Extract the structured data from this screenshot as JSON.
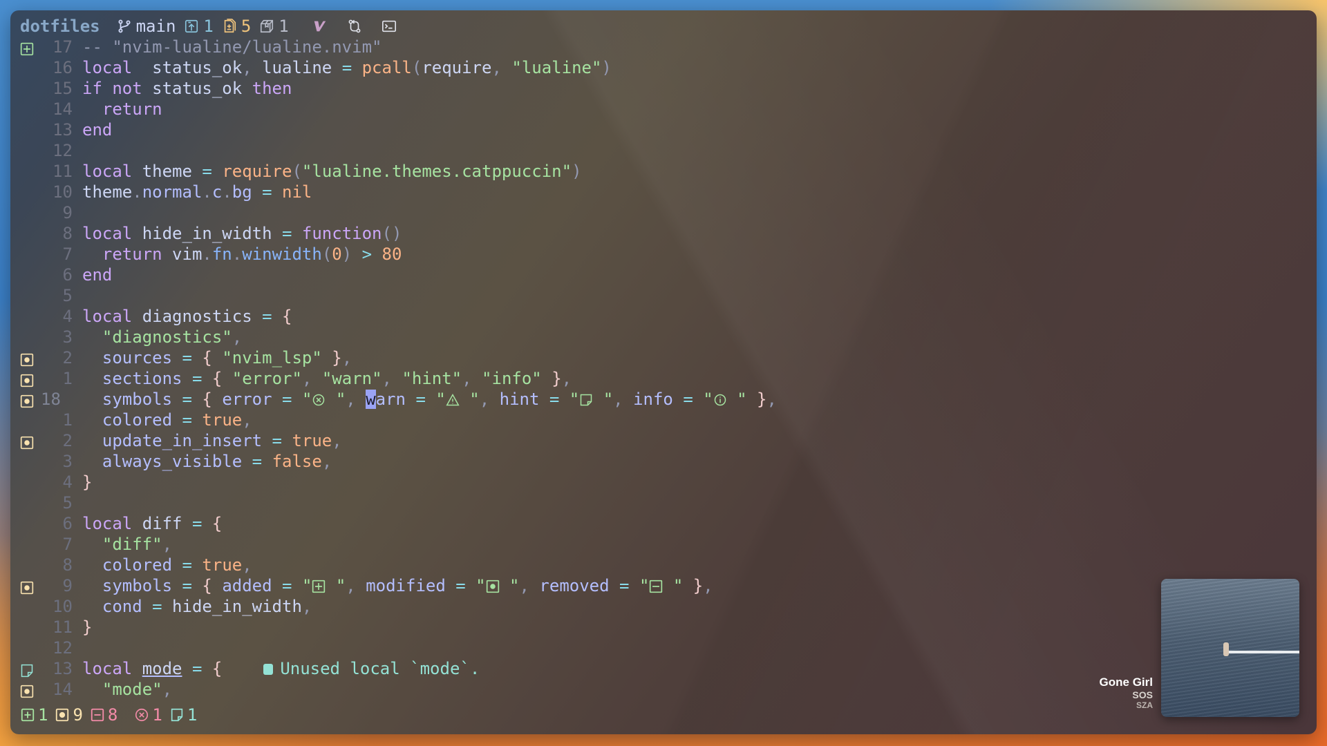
{
  "topbar": {
    "project": "dotfiles",
    "branch": "main",
    "ahead_count": "1",
    "changed_files_count": "5",
    "package_count": "1",
    "icons": [
      "git-branch-icon",
      "push-icon",
      "diff-file-icon",
      "package-icon",
      "vim-icon",
      "pull-request-icon",
      "terminal-icon"
    ]
  },
  "editor": {
    "lines": [
      {
        "num": "17",
        "sign": "added",
        "tokens": [
          [
            "cm",
            "-- \"nvim-lualine/lualine.nvim\""
          ]
        ]
      },
      {
        "num": "16",
        "sign": "",
        "tokens": [
          [
            "kw",
            "local"
          ],
          [
            "",
            "  status_ok"
          ],
          [
            "punc",
            ","
          ],
          [
            "",
            " lualine "
          ],
          [
            "op",
            "="
          ],
          [
            "",
            " "
          ],
          [
            "fn",
            "pcall"
          ],
          [
            "punc",
            "("
          ],
          [
            "",
            "require"
          ],
          [
            "punc",
            ","
          ],
          [
            "",
            " "
          ],
          [
            "str",
            "\"lualine\""
          ],
          [
            "punc",
            ")"
          ]
        ]
      },
      {
        "num": "15",
        "sign": "",
        "tokens": [
          [
            "kw",
            "if not"
          ],
          [
            "",
            " status_ok "
          ],
          [
            "kw",
            "then"
          ]
        ]
      },
      {
        "num": "14",
        "sign": "",
        "tokens": [
          [
            "",
            "  "
          ],
          [
            "kw",
            "return"
          ]
        ]
      },
      {
        "num": "13",
        "sign": "",
        "tokens": [
          [
            "kw",
            "end"
          ]
        ]
      },
      {
        "num": "12",
        "sign": "",
        "tokens": []
      },
      {
        "num": "11",
        "sign": "",
        "tokens": [
          [
            "kw",
            "local"
          ],
          [
            "",
            " theme "
          ],
          [
            "op",
            "="
          ],
          [
            "",
            " "
          ],
          [
            "fn",
            "require"
          ],
          [
            "punc",
            "("
          ],
          [
            "str",
            "\"lualine.themes.catppuccin\""
          ],
          [
            "punc",
            ")"
          ]
        ]
      },
      {
        "num": "10",
        "sign": "",
        "tokens": [
          [
            "",
            "theme"
          ],
          [
            "punc",
            "."
          ],
          [
            "field",
            "normal"
          ],
          [
            "punc",
            "."
          ],
          [
            "field",
            "c"
          ],
          [
            "punc",
            "."
          ],
          [
            "field",
            "bg"
          ],
          [
            "",
            " "
          ],
          [
            "op",
            "="
          ],
          [
            "",
            " "
          ],
          [
            "num",
            "nil"
          ]
        ]
      },
      {
        "num": "9",
        "sign": "",
        "tokens": []
      },
      {
        "num": "8",
        "sign": "",
        "tokens": [
          [
            "kw",
            "local"
          ],
          [
            "",
            " hide_in_width "
          ],
          [
            "op",
            "="
          ],
          [
            "",
            " "
          ],
          [
            "kw",
            "function"
          ],
          [
            "punc",
            "()"
          ]
        ]
      },
      {
        "num": "7",
        "sign": "",
        "tokens": [
          [
            "",
            "  "
          ],
          [
            "kw",
            "return"
          ],
          [
            "",
            " vim"
          ],
          [
            "punc",
            "."
          ],
          [
            "blue",
            "fn"
          ],
          [
            "punc",
            "."
          ],
          [
            "blue",
            "winwidth"
          ],
          [
            "punc",
            "("
          ],
          [
            "num",
            "0"
          ],
          [
            "punc",
            ")"
          ],
          [
            "",
            " "
          ],
          [
            "op",
            ">"
          ],
          [
            "",
            " "
          ],
          [
            "num",
            "80"
          ]
        ]
      },
      {
        "num": "6",
        "sign": "",
        "tokens": [
          [
            "kw",
            "end"
          ]
        ]
      },
      {
        "num": "5",
        "sign": "",
        "tokens": []
      },
      {
        "num": "4",
        "sign": "",
        "tokens": [
          [
            "kw",
            "local"
          ],
          [
            "",
            " diagnostics "
          ],
          [
            "op",
            "="
          ],
          [
            "",
            " "
          ],
          [
            "brace",
            "{"
          ]
        ]
      },
      {
        "num": "3",
        "sign": "",
        "tokens": [
          [
            "",
            "  "
          ],
          [
            "str",
            "\"diagnostics\""
          ],
          [
            "punc",
            ","
          ]
        ]
      },
      {
        "num": "2",
        "sign": "modified",
        "tokens": [
          [
            "",
            "  "
          ],
          [
            "field",
            "sources"
          ],
          [
            "",
            " "
          ],
          [
            "op",
            "="
          ],
          [
            "",
            " "
          ],
          [
            "brace",
            "{"
          ],
          [
            "",
            " "
          ],
          [
            "str",
            "\"nvim_lsp\""
          ],
          [
            "",
            " "
          ],
          [
            "brace",
            "}"
          ],
          [
            "punc",
            ","
          ]
        ]
      },
      {
        "num": "1",
        "sign": "modified",
        "tokens": [
          [
            "",
            "  "
          ],
          [
            "field",
            "sections"
          ],
          [
            "",
            " "
          ],
          [
            "op",
            "="
          ],
          [
            "",
            " "
          ],
          [
            "brace",
            "{"
          ],
          [
            "",
            " "
          ],
          [
            "str",
            "\"error\""
          ],
          [
            "punc",
            ","
          ],
          [
            "",
            " "
          ],
          [
            "str",
            "\"warn\""
          ],
          [
            "punc",
            ","
          ],
          [
            "",
            " "
          ],
          [
            "str",
            "\"hint\""
          ],
          [
            "punc",
            ","
          ],
          [
            "",
            " "
          ],
          [
            "str",
            "\"info\""
          ],
          [
            "",
            " "
          ],
          [
            "brace",
            "}"
          ],
          [
            "punc",
            ","
          ]
        ]
      },
      {
        "num": "18",
        "sign": "modified",
        "current": true,
        "tokens": [
          [
            "",
            "  "
          ],
          [
            "field",
            "symbols"
          ],
          [
            "",
            " "
          ],
          [
            "op",
            "="
          ],
          [
            "",
            " "
          ],
          [
            "brace",
            "{"
          ],
          [
            "",
            " "
          ],
          [
            "field",
            "error"
          ],
          [
            "",
            " "
          ],
          [
            "op",
            "="
          ],
          [
            "",
            " "
          ],
          [
            "str",
            "\""
          ],
          [
            "glyph",
            "error"
          ],
          [
            "str",
            " \""
          ],
          [
            "punc",
            ","
          ],
          [
            "",
            " "
          ],
          [
            "cursor",
            "w"
          ],
          [
            "field",
            "arn"
          ],
          [
            "",
            " "
          ],
          [
            "op",
            "="
          ],
          [
            "",
            " "
          ],
          [
            "str",
            "\""
          ],
          [
            "glyph",
            "warn"
          ],
          [
            "str",
            " \""
          ],
          [
            "punc",
            ","
          ],
          [
            "",
            " "
          ],
          [
            "field",
            "hint"
          ],
          [
            "",
            " "
          ],
          [
            "op",
            "="
          ],
          [
            "",
            " "
          ],
          [
            "str",
            "\""
          ],
          [
            "glyph",
            "hint"
          ],
          [
            "str",
            " \""
          ],
          [
            "punc",
            ","
          ],
          [
            "",
            " "
          ],
          [
            "field",
            "info"
          ],
          [
            "",
            " "
          ],
          [
            "op",
            "="
          ],
          [
            "",
            " "
          ],
          [
            "str",
            "\""
          ],
          [
            "glyph",
            "info"
          ],
          [
            "str",
            " \""
          ],
          [
            "",
            " "
          ],
          [
            "brace",
            "}"
          ],
          [
            "punc",
            ","
          ]
        ]
      },
      {
        "num": "1",
        "sign": "",
        "tokens": [
          [
            "",
            "  "
          ],
          [
            "field",
            "colored"
          ],
          [
            "",
            " "
          ],
          [
            "op",
            "="
          ],
          [
            "",
            " "
          ],
          [
            "num",
            "true"
          ],
          [
            "punc",
            ","
          ]
        ]
      },
      {
        "num": "2",
        "sign": "modified",
        "tokens": [
          [
            "",
            "  "
          ],
          [
            "field",
            "update_in_insert"
          ],
          [
            "",
            " "
          ],
          [
            "op",
            "="
          ],
          [
            "",
            " "
          ],
          [
            "num",
            "true"
          ],
          [
            "punc",
            ","
          ]
        ]
      },
      {
        "num": "3",
        "sign": "",
        "tokens": [
          [
            "",
            "  "
          ],
          [
            "field",
            "always_visible"
          ],
          [
            "",
            " "
          ],
          [
            "op",
            "="
          ],
          [
            "",
            " "
          ],
          [
            "num",
            "false"
          ],
          [
            "punc",
            ","
          ]
        ]
      },
      {
        "num": "4",
        "sign": "",
        "tokens": [
          [
            "brace",
            "}"
          ]
        ]
      },
      {
        "num": "5",
        "sign": "",
        "tokens": []
      },
      {
        "num": "6",
        "sign": "",
        "tokens": [
          [
            "kw",
            "local"
          ],
          [
            "",
            " diff "
          ],
          [
            "op",
            "="
          ],
          [
            "",
            " "
          ],
          [
            "brace",
            "{"
          ]
        ]
      },
      {
        "num": "7",
        "sign": "",
        "tokens": [
          [
            "",
            "  "
          ],
          [
            "str",
            "\"diff\""
          ],
          [
            "punc",
            ","
          ]
        ]
      },
      {
        "num": "8",
        "sign": "",
        "tokens": [
          [
            "",
            "  "
          ],
          [
            "field",
            "colored"
          ],
          [
            "",
            " "
          ],
          [
            "op",
            "="
          ],
          [
            "",
            " "
          ],
          [
            "num",
            "true"
          ],
          [
            "punc",
            ","
          ]
        ]
      },
      {
        "num": "9",
        "sign": "modified",
        "tokens": [
          [
            "",
            "  "
          ],
          [
            "field",
            "symbols"
          ],
          [
            "",
            " "
          ],
          [
            "op",
            "="
          ],
          [
            "",
            " "
          ],
          [
            "brace",
            "{"
          ],
          [
            "",
            " "
          ],
          [
            "field",
            "added"
          ],
          [
            "",
            " "
          ],
          [
            "op",
            "="
          ],
          [
            "",
            " "
          ],
          [
            "str",
            "\""
          ],
          [
            "glyph",
            "added"
          ],
          [
            "str",
            " \""
          ],
          [
            "punc",
            ","
          ],
          [
            "",
            " "
          ],
          [
            "field",
            "modified"
          ],
          [
            "",
            " "
          ],
          [
            "op",
            "="
          ],
          [
            "",
            " "
          ],
          [
            "str",
            "\""
          ],
          [
            "glyph",
            "modified"
          ],
          [
            "str",
            " \""
          ],
          [
            "punc",
            ","
          ],
          [
            "",
            " "
          ],
          [
            "field",
            "removed"
          ],
          [
            "",
            " "
          ],
          [
            "op",
            "="
          ],
          [
            "",
            " "
          ],
          [
            "str",
            "\""
          ],
          [
            "glyph",
            "removed"
          ],
          [
            "str",
            " \""
          ],
          [
            "",
            " "
          ],
          [
            "brace",
            "}"
          ],
          [
            "punc",
            ","
          ]
        ]
      },
      {
        "num": "10",
        "sign": "",
        "tokens": [
          [
            "",
            "  "
          ],
          [
            "field",
            "cond"
          ],
          [
            "",
            " "
          ],
          [
            "op",
            "="
          ],
          [
            "",
            " hide_in_width"
          ],
          [
            "punc",
            ","
          ]
        ]
      },
      {
        "num": "11",
        "sign": "",
        "tokens": [
          [
            "brace",
            "}"
          ]
        ]
      },
      {
        "num": "12",
        "sign": "",
        "tokens": []
      },
      {
        "num": "13",
        "sign": "hint",
        "tokens": [
          [
            "kw",
            "local"
          ],
          [
            "",
            " "
          ],
          [
            "under",
            "mode"
          ],
          [
            "",
            " "
          ],
          [
            "op",
            "="
          ],
          [
            "",
            " "
          ],
          [
            "brace",
            "{"
          ]
        ],
        "virtual_text": "Unused local `mode`."
      },
      {
        "num": "14",
        "sign": "modified",
        "tokens": [
          [
            "",
            "  "
          ],
          [
            "str",
            "\"mode\""
          ],
          [
            "punc",
            ","
          ]
        ]
      }
    ]
  },
  "statusline": {
    "added": "1",
    "modified": "9",
    "removed": "8",
    "errors": "1",
    "hints": "1"
  },
  "now_playing": {
    "title": "Gone Girl",
    "album": "SOS",
    "artist": "SZA"
  },
  "colors": {
    "added": "#a6e3a1",
    "modified": "#f9e2af",
    "removed": "#f38ba8",
    "error": "#f38ba8",
    "hint": "#94e2d5"
  }
}
